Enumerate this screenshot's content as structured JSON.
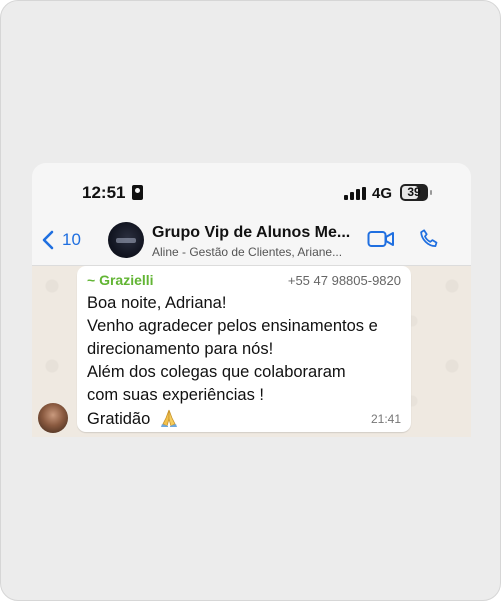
{
  "status_bar": {
    "time": "12:51",
    "network": "4G",
    "battery": "39",
    "id_icon": "person-card-icon",
    "signal_icon": "signal-bars-icon"
  },
  "header": {
    "back_count": "10",
    "group_name": "Grupo Vip de Alunos Me...",
    "participants": "Aline - Gestão de Clientes, Ariane...",
    "video_icon": "video-call-icon",
    "phone_icon": "phone-call-icon",
    "accent_color": "#1f6fe0"
  },
  "message": {
    "sender": "~ Grazielli",
    "sender_phone": "+55 47 98805-9820",
    "lines": [
      "Boa noite, Adriana!",
      "Venho agradecer pelos ensinamentos e",
      "direcionamento para nós!",
      "Além  dos colegas que colaboraram",
      "com suas experiências !",
      "Gratidão"
    ],
    "emoji": "folded-hands-icon",
    "time": "21:41",
    "sender_color": "#62b534"
  }
}
